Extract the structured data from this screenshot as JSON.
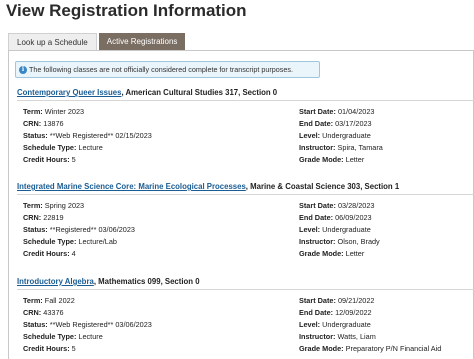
{
  "page": {
    "title": "View Registration Information"
  },
  "tabs": [
    {
      "label": "Look up a Schedule",
      "active": false
    },
    {
      "label": "Active Registrations",
      "active": true
    }
  ],
  "notice": {
    "icon": "info-icon",
    "text": "The following classes are not officially considered complete for transcript purposes."
  },
  "labels": {
    "term": "Term:",
    "crn": "CRN:",
    "status": "Status:",
    "schedule_type": "Schedule Type:",
    "credit_hours": "Credit Hours:",
    "start_date": "Start Date:",
    "end_date": "End Date:",
    "level": "Level:",
    "instructor": "Instructor:",
    "grade_mode": "Grade Mode:"
  },
  "courses": [
    {
      "title": "Contemporary Queer Issues",
      "subtitle": ", American Cultural Studies 317, Section 0",
      "term": "Winter 2023",
      "crn": "13876",
      "status": "**Web Registered** 02/15/2023",
      "schedule_type": "Lecture",
      "credit_hours": "5",
      "start_date": "01/04/2023",
      "end_date": "03/17/2023",
      "level": "Undergraduate",
      "instructor": "Spira, Tamara",
      "grade_mode": "Letter"
    },
    {
      "title": "Integrated Marine Science Core: Marine Ecological Processes",
      "subtitle": ", Marine & Coastal Science 303, Section 1",
      "term": "Spring 2023",
      "crn": "22819",
      "status": "**Registered** 03/06/2023",
      "schedule_type": "Lecture/Lab",
      "credit_hours": "4",
      "start_date": "03/28/2023",
      "end_date": "06/09/2023",
      "level": "Undergraduate",
      "instructor": "Olson, Brady",
      "grade_mode": "Letter"
    },
    {
      "title": "Introductory Algebra",
      "subtitle": ", Mathematics 099, Section 0",
      "term": "Fall 2022",
      "crn": "43376",
      "status": "**Web Registered** 03/06/2023",
      "schedule_type": "Lecture",
      "credit_hours": "5",
      "start_date": "09/21/2022",
      "end_date": "12/09/2022",
      "level": "Undergraduate",
      "instructor": "Watts, Liam",
      "grade_mode": "Preparatory P/N Financial Aid"
    }
  ]
}
